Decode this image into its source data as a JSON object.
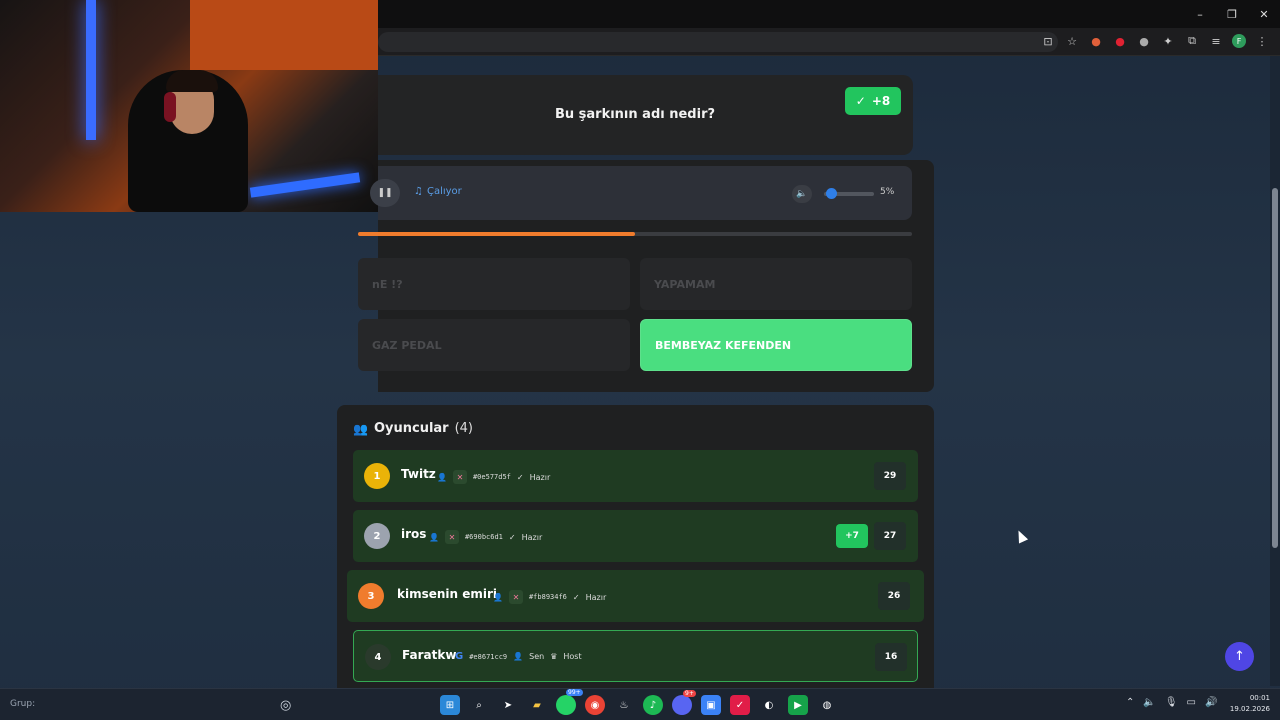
{
  "question": {
    "text": "Bu şarkının adı nedir?",
    "score": "+8"
  },
  "player": {
    "status": "Çalıyor",
    "volume_label": "5%",
    "volume": 0.05,
    "progress": 0.5
  },
  "answers": [
    {
      "label": "nE !?",
      "correct": false
    },
    {
      "label": "YAPAMAM",
      "correct": false
    },
    {
      "label": "GAZ PEDAL",
      "correct": false
    },
    {
      "label": "BEMBEYAZ KEFENDEN",
      "correct": true
    }
  ],
  "players_panel": {
    "title": "Oyuncular",
    "count": "(4)",
    "players": [
      {
        "rank": "1",
        "name": "Twitz",
        "id": "#0e577d5f",
        "status": "Hazır",
        "points": "29",
        "delta": "",
        "rank_color": "#eab308"
      },
      {
        "rank": "2",
        "name": "iros",
        "id": "#690bc6d1",
        "status": "Hazır",
        "points": "27",
        "delta": "+7",
        "rank_color": "#9ca3af"
      },
      {
        "rank": "3",
        "name": "kimsenin emiri",
        "id": "#fb8934f6",
        "status": "Hazır",
        "points": "26",
        "delta": "",
        "rank_color": "#f07c2d"
      },
      {
        "rank": "4",
        "name": "Faratkw",
        "id": "#e8671cc9",
        "you_label": "Sen",
        "host_label": "Host",
        "points": "16",
        "delta": "",
        "rank_color": "#2a3a2c"
      }
    ]
  },
  "taskbar": {
    "search_label": "Grup:",
    "chrome_badge": "99+",
    "discord_badge": "9+",
    "time": "00:01",
    "date": "19.02.2026"
  },
  "colors": {
    "accent": "#22c55e",
    "progress": "#f07c2d",
    "scroll_top": "#4f46e5"
  }
}
